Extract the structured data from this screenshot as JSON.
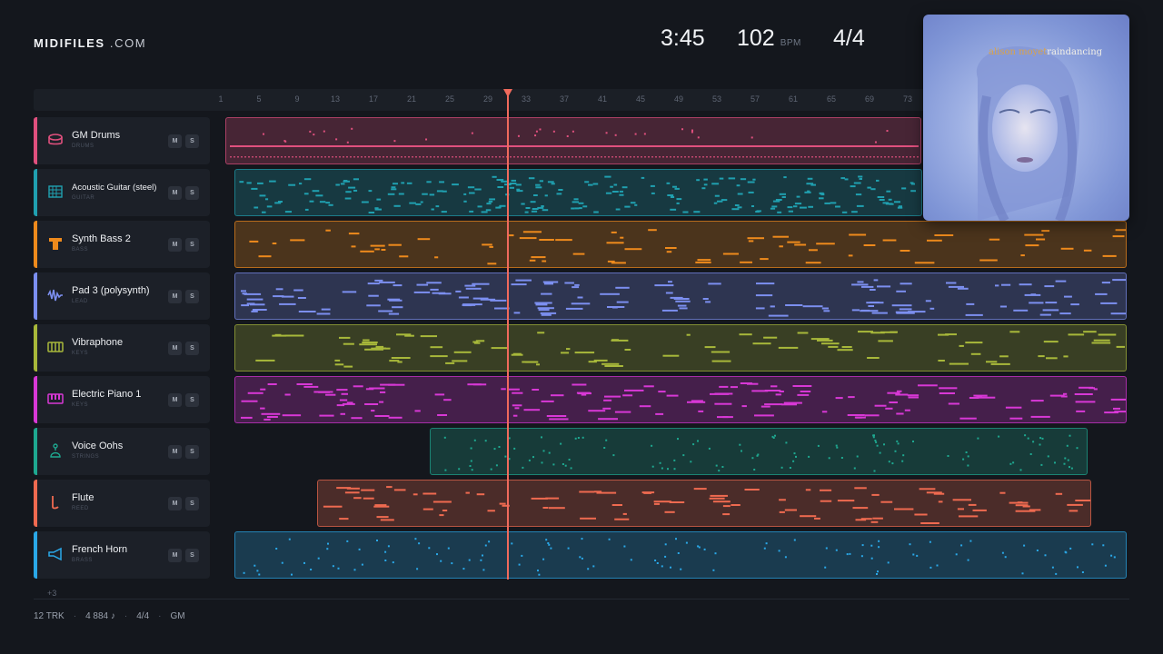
{
  "brand": {
    "bold": "MIDIFILES",
    "light": " .COM"
  },
  "transport": {
    "time": "3:45",
    "bpm": "102",
    "bpm_unit": "BPM",
    "time_signature": "4/4"
  },
  "ruler": {
    "ticks": [
      "1",
      "5",
      "9",
      "13",
      "17",
      "21",
      "25",
      "29",
      "33",
      "37",
      "41",
      "45",
      "49",
      "53",
      "57",
      "61",
      "65",
      "69",
      "73"
    ]
  },
  "tracks": [
    {
      "name": "GM Drums",
      "category": "DRUMS",
      "color": "#e0507e",
      "icon": "drum-icon"
    },
    {
      "name": "Acoustic Guitar (steel)",
      "category": "GUITAR",
      "color": "#20a0b0",
      "icon": "guitar-icon"
    },
    {
      "name": "Synth Bass 2",
      "category": "BASS",
      "color": "#ee8a1c",
      "icon": "bass-icon"
    },
    {
      "name": "Pad 3 (polysynth)",
      "category": "LEAD",
      "color": "#7c8ff0",
      "icon": "wave-icon"
    },
    {
      "name": "Vibraphone",
      "category": "KEYS",
      "color": "#a8b83a",
      "icon": "keys-icon"
    },
    {
      "name": "Electric Piano 1",
      "category": "KEYS",
      "color": "#d838d6",
      "icon": "piano-icon"
    },
    {
      "name": "Voice Oohs",
      "category": "STRINGS",
      "color": "#1ea890",
      "icon": "voice-icon"
    },
    {
      "name": "Flute",
      "category": "REED",
      "color": "#ef6a50",
      "icon": "flute-icon"
    },
    {
      "name": "French Horn",
      "category": "BRASS",
      "color": "#2aa8e8",
      "icon": "horn-icon"
    }
  ],
  "buttons": {
    "mute": "M",
    "solo": "S"
  },
  "more_tracks": "+3",
  "footer": {
    "tracks": "12 TRK",
    "notes": "4 884 ♪",
    "signature": "4/4",
    "standard": "GM",
    "separator": "·"
  },
  "album": {
    "artist": "alison moyet",
    "title": "raindancing"
  }
}
